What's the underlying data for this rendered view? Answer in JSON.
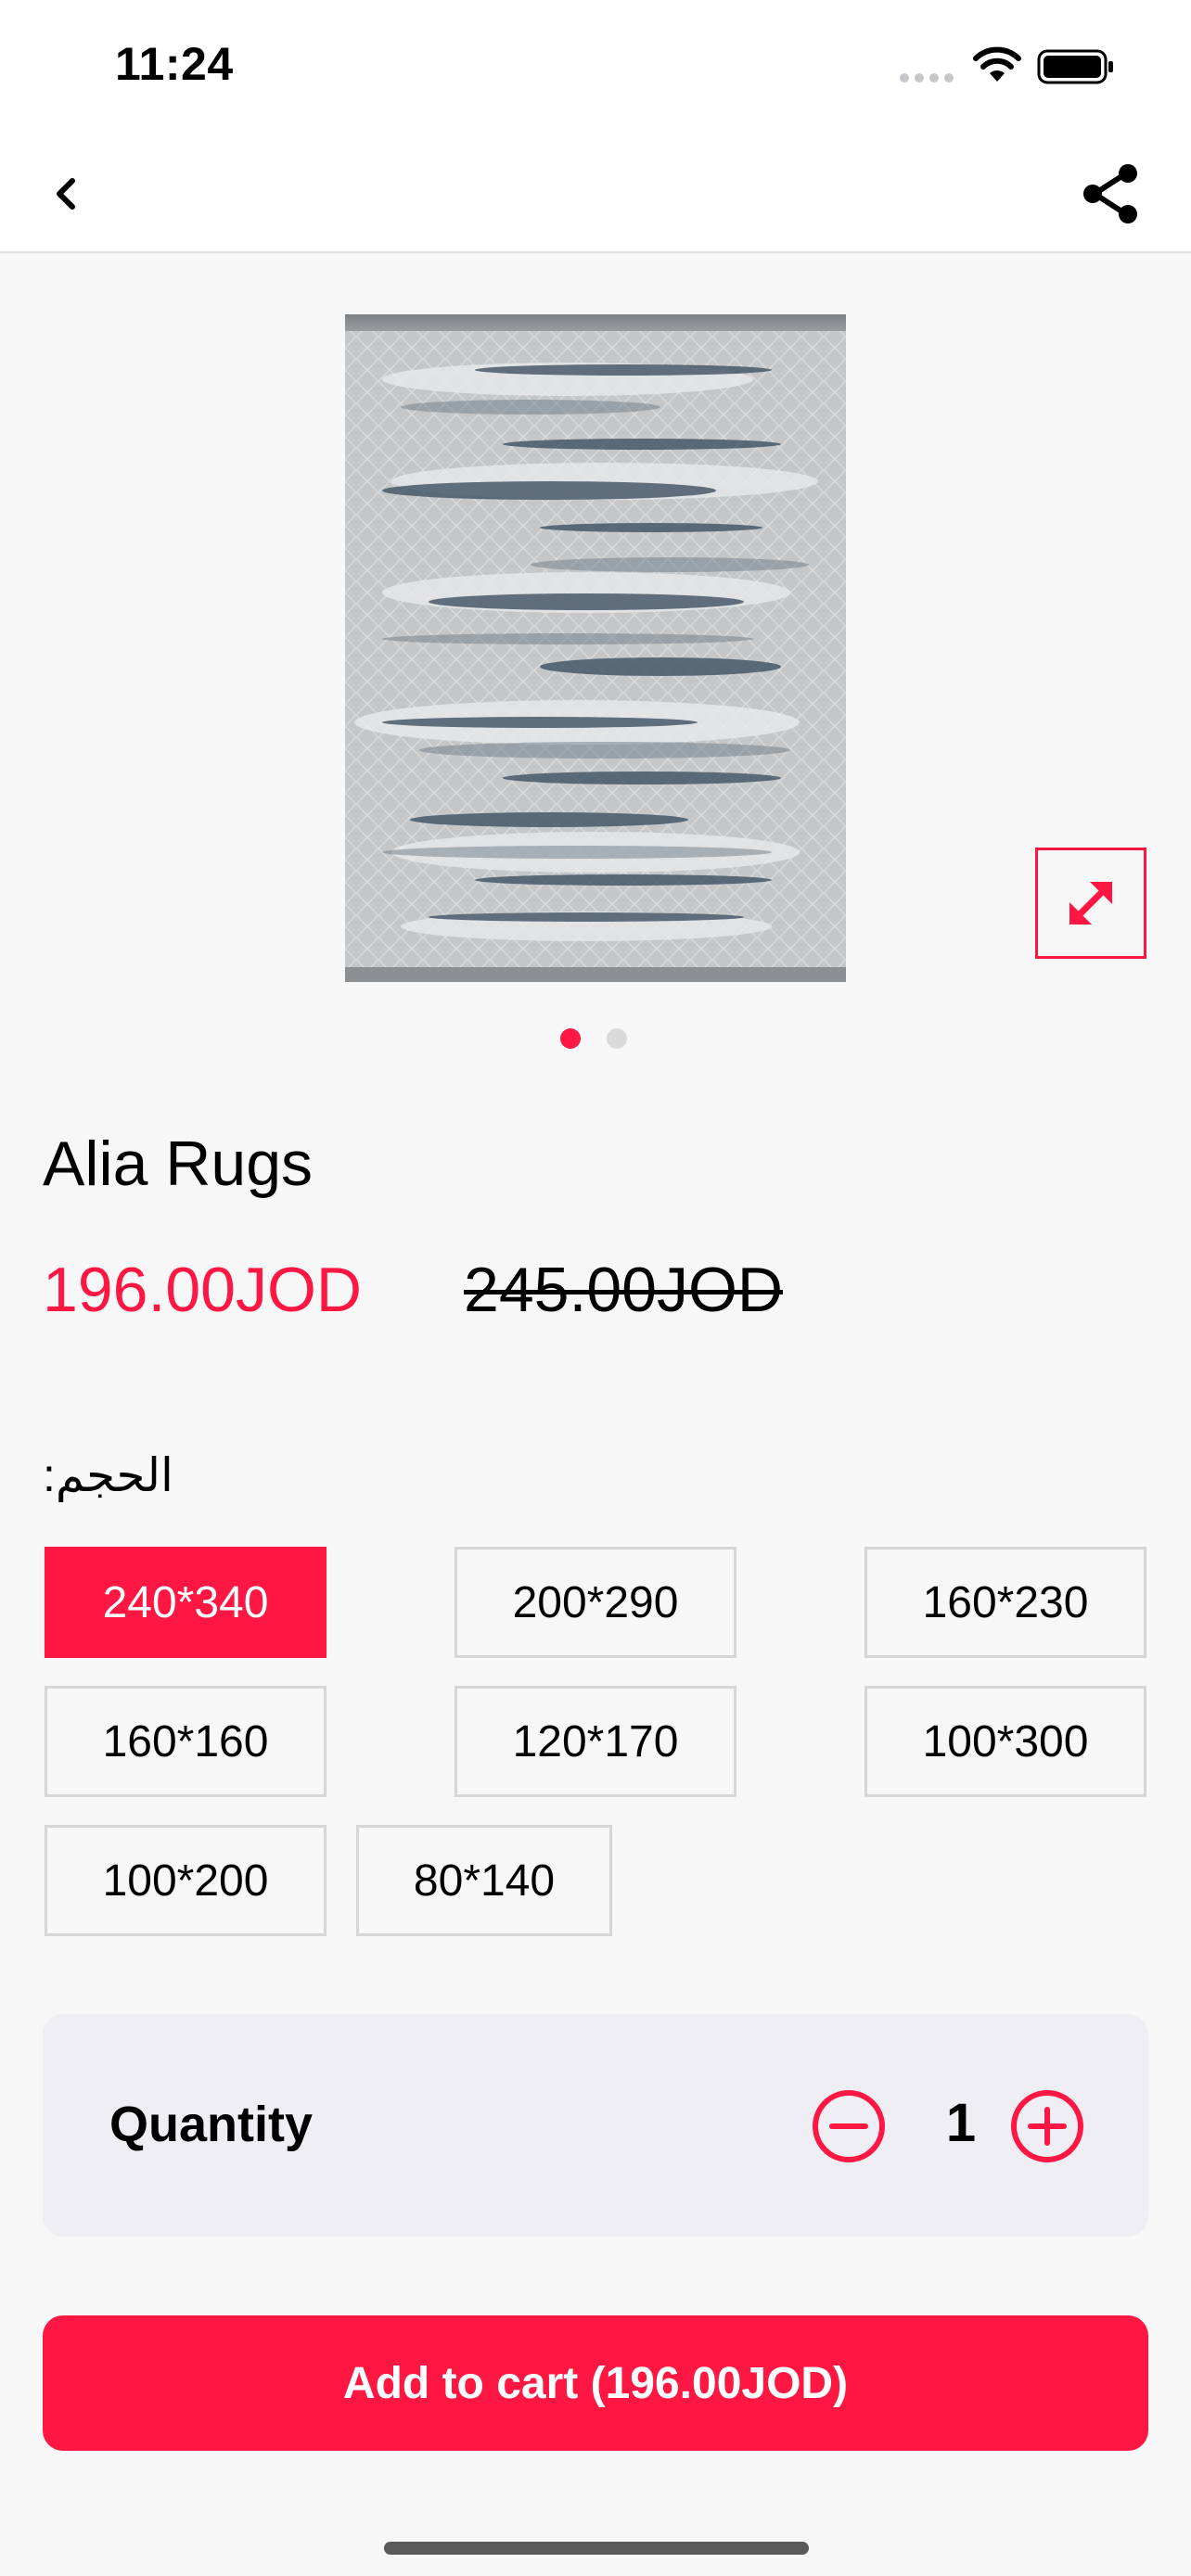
{
  "status_bar": {
    "time": "11:24",
    "icons": [
      "signal-icon",
      "wifi-icon",
      "battery-icon"
    ]
  },
  "nav": {
    "back_icon": "chevron-left-icon",
    "share_icon": "share-icon"
  },
  "gallery": {
    "image_description_icon": "rug-image",
    "expand_icon": "expand-icon",
    "page_count": 2,
    "active_page": 1
  },
  "product": {
    "name": "Alia Rugs",
    "price": "196.00JOD",
    "old_price": "245.00JOD"
  },
  "size": {
    "label": "الحجم:",
    "options": [
      "240*340",
      "200*290",
      "160*230",
      "160*160",
      "120*170",
      "100*300",
      "100*200",
      "80*140"
    ],
    "selected_index": 0
  },
  "quantity": {
    "label": "Quantity",
    "value": "1",
    "minus_icon": "minus-circle-icon",
    "plus_icon": "plus-circle-icon"
  },
  "cart": {
    "button_label": "Add to cart (196.00JOD)"
  },
  "colors": {
    "accent": "#ff1744",
    "background": "#f7f7f8",
    "panel": "#efeff3"
  }
}
